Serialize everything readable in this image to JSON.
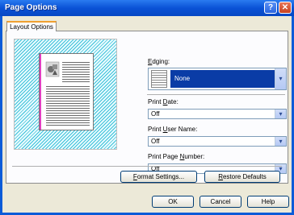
{
  "window": {
    "title": "Page Options",
    "help_glyph": "?",
    "close_glyph": "✕"
  },
  "tabs": [
    {
      "label": "Layout Options",
      "active": true
    }
  ],
  "edging": {
    "label_pre": "",
    "label_ul": "E",
    "label_post": "dging:",
    "value": "None"
  },
  "print_date": {
    "label_pre": "Print ",
    "label_ul": "D",
    "label_post": "ate:",
    "value": "Off"
  },
  "print_user_name": {
    "label_pre": "Print ",
    "label_ul": "U",
    "label_post": "ser Name:",
    "value": "Off"
  },
  "print_page_number": {
    "label_pre": "Print Page ",
    "label_ul": "N",
    "label_post": "umber:",
    "value": "Off"
  },
  "buttons": {
    "format_settings": {
      "pre": "",
      "ul": "F",
      "post": "ormat Settings..."
    },
    "restore_defaults": {
      "pre": "",
      "ul": "R",
      "post": "estore Defaults"
    },
    "ok": "OK",
    "cancel": "Cancel",
    "help": "Help"
  },
  "colors": {
    "titlebar": "#0a52d6",
    "selection": "#0a3ca6",
    "edge_marker": "#e040c0",
    "preview_hatch": "#3cc0d8"
  },
  "icons": {
    "help": "help-icon",
    "close": "close-icon",
    "dropdown": "chevron-down-icon"
  }
}
